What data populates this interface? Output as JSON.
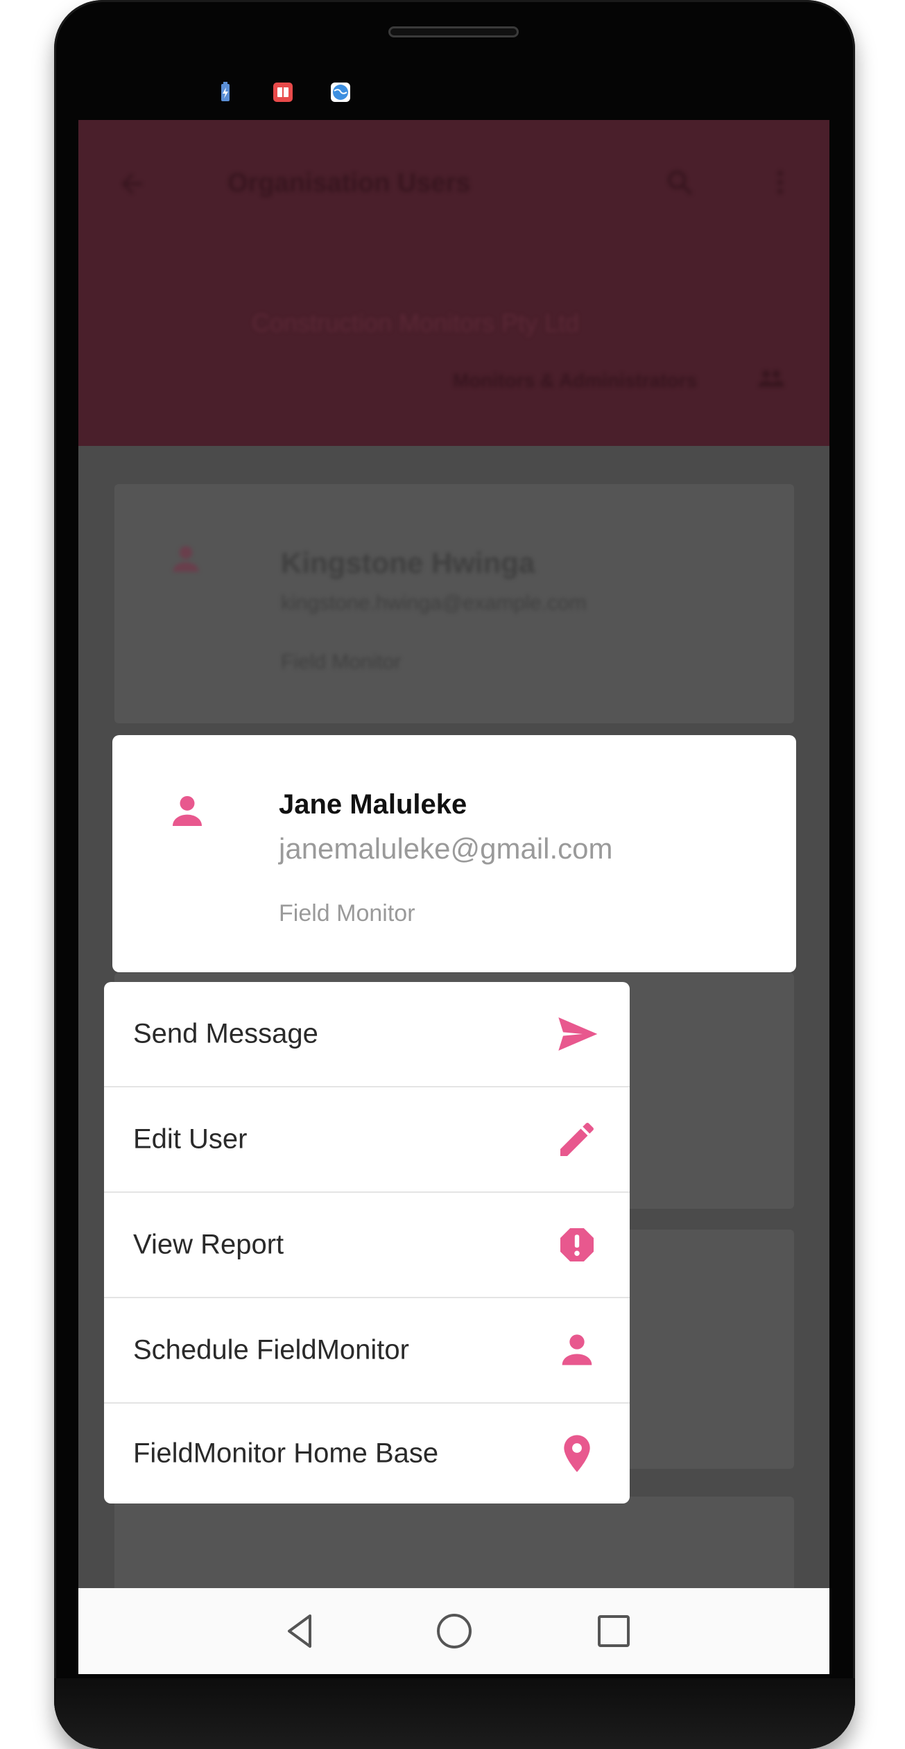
{
  "user_card": {
    "name": "Jane Maluleke",
    "email": "janemaluleke@gmail.com",
    "role": "Field Monitor"
  },
  "menu": {
    "items": [
      {
        "label": "Send Message",
        "icon": "send-icon"
      },
      {
        "label": "Edit User",
        "icon": "pencil-icon"
      },
      {
        "label": "View Report",
        "icon": "alert-octagon-icon"
      },
      {
        "label": "Schedule FieldMonitor",
        "icon": "person-icon"
      },
      {
        "label": "FieldMonitor Home Base",
        "icon": "location-pin-icon"
      }
    ]
  },
  "background": {
    "appbar_title": "Organisation Users",
    "org_name": "Construction Monitors Pty Ltd",
    "subtitle": "Monitors & Administrators",
    "card_name": "Kingstone Hwinga",
    "card_email": "kingstone.hwinga@example.com",
    "card_role": "Field Monitor"
  },
  "colors": {
    "accent": "#e8588e",
    "appbar": "#4a1f2b",
    "scrim": "#4b4b4b"
  }
}
